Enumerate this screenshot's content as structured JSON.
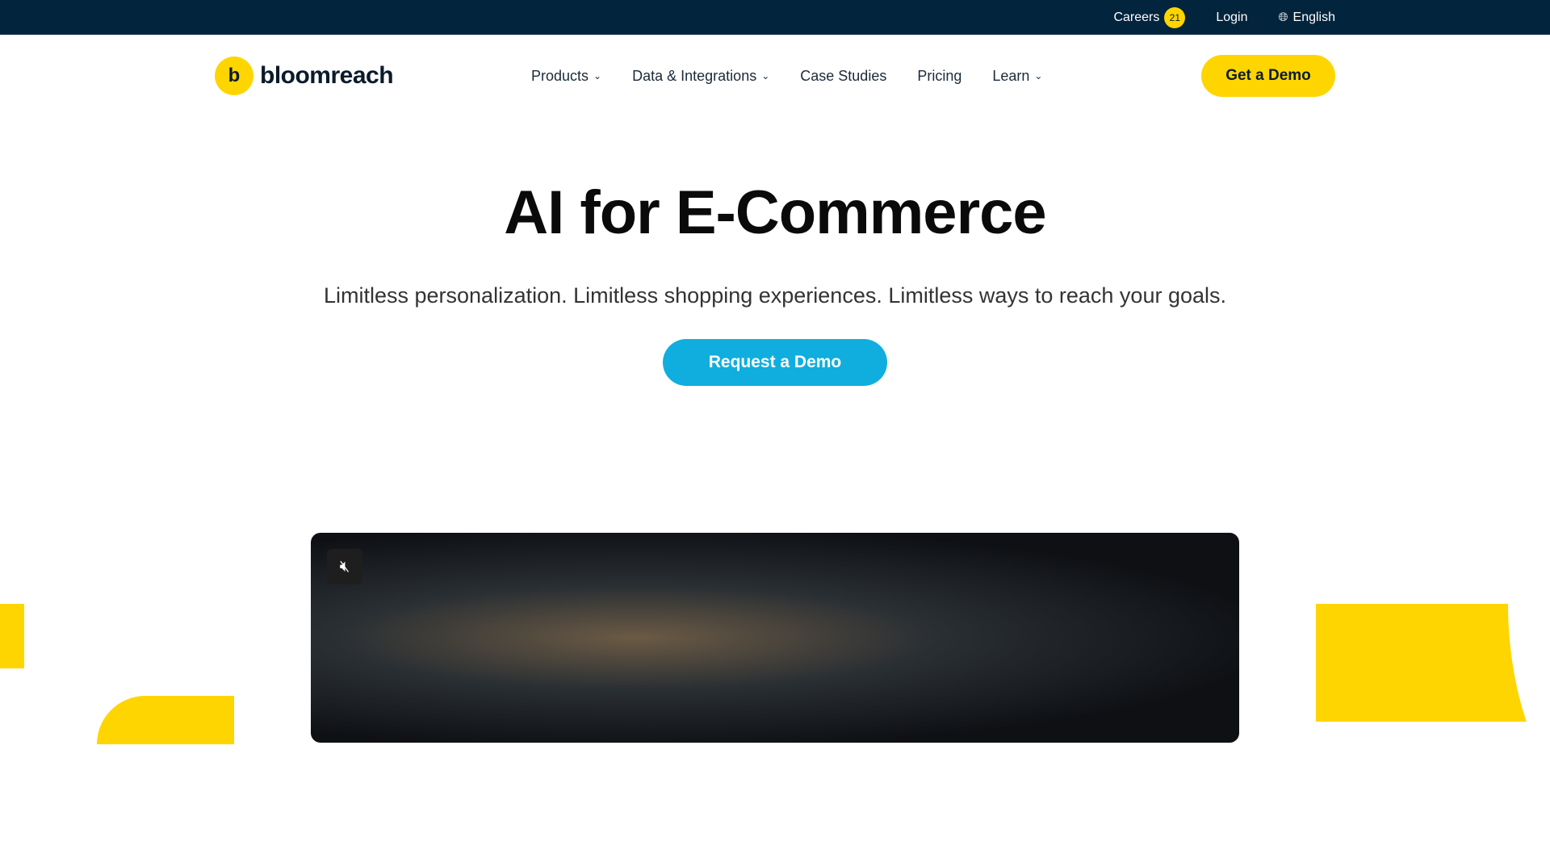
{
  "topbar": {
    "careers_label": "Careers",
    "careers_count": "21",
    "login_label": "Login",
    "language_label": "English"
  },
  "nav": {
    "logo_text": "bloomreach",
    "logo_mark": "b",
    "items": [
      {
        "label": "Products",
        "dropdown": true
      },
      {
        "label": "Data & Integrations",
        "dropdown": true
      },
      {
        "label": "Case Studies",
        "dropdown": false
      },
      {
        "label": "Pricing",
        "dropdown": false
      },
      {
        "label": "Learn",
        "dropdown": true
      }
    ],
    "cta_label": "Get a Demo"
  },
  "hero": {
    "title": "AI for E-Commerce",
    "subtitle": "Limitless personalization. Limitless shopping experiences. Limitless ways to reach your goals.",
    "cta_label": "Request a Demo"
  },
  "video": {
    "mute_icon": "speaker-muted-icon"
  },
  "colors": {
    "topbar_bg": "#03243d",
    "brand_yellow": "#ffd500",
    "cta_blue": "#10aede"
  }
}
